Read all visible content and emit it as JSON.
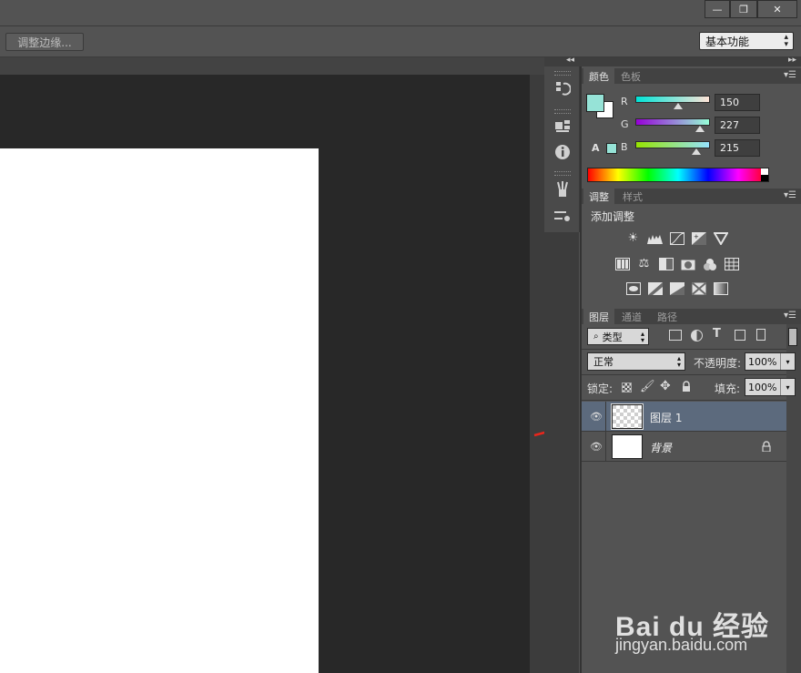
{
  "window": {
    "minimize": "—",
    "restore": "❐",
    "close": "✕"
  },
  "options_bar": {
    "refine_edge": "调整边缘...",
    "workspace": "基本功能"
  },
  "color_panel": {
    "tabs": [
      "颜色",
      "色板"
    ],
    "channels": [
      {
        "label": "R",
        "value": "150",
        "fraction": 0.588
      },
      {
        "label": "G",
        "value": "227",
        "fraction": 0.89
      },
      {
        "label": "B",
        "value": "215",
        "fraction": 0.843
      }
    ],
    "foreground_color": "#96e3d7",
    "background_color": "#ffffff"
  },
  "adjustments_panel": {
    "tabs": [
      "调整",
      "样式"
    ],
    "heading": "添加调整",
    "icons": [
      [
        "brightness-contrast-icon",
        "levels-icon",
        "curves-icon",
        "exposure-icon",
        "vibrance-icon"
      ],
      [
        "hue-saturation-icon",
        "color-balance-icon",
        "black-white-icon",
        "photo-filter-icon",
        "channel-mixer-icon",
        "color-lookup-icon"
      ],
      [
        "invert-icon",
        "posterize-icon",
        "threshold-icon",
        "selective-color-icon",
        "gradient-map-icon"
      ]
    ]
  },
  "layers_panel": {
    "tabs": [
      "图层",
      "通道",
      "路径"
    ],
    "filter_kind": "类型",
    "blend_mode": "正常",
    "opacity_label": "不透明度:",
    "opacity": "100%",
    "lock_label": "锁定:",
    "fill_label": "填充:",
    "fill": "100%",
    "layers": [
      {
        "name": "图层 1",
        "selected": true,
        "transparent": true
      },
      {
        "name": "背景",
        "selected": false,
        "transparent": false,
        "locked": true
      }
    ]
  },
  "watermark": {
    "brand": "Bai du 经验",
    "url": "jingyan.baidu.com"
  }
}
